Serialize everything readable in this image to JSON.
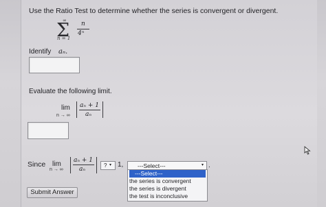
{
  "question": "Use the Ratio Test to determine whether the series is convergent or divergent.",
  "series": {
    "upper": "∞",
    "lower": "n = 1",
    "numerator": "n",
    "denominator": "4ⁿ"
  },
  "identify_label": "Identify",
  "identify_symbol": "aₙ.",
  "evaluate_label": "Evaluate the following limit.",
  "limit": {
    "lim": "lim",
    "sub": "n → ∞",
    "numerator": "aₙ + 1",
    "denominator": "aₙ"
  },
  "since": {
    "label": "Since",
    "compare_value": "?",
    "compare_arrow": "▾",
    "one": "1,",
    "dropdown_selected": "---Select---",
    "dropdown_arrow": "▾",
    "trailing_dot": "."
  },
  "options": [
    "---Select---",
    "the series is convergent",
    "the series is divergent",
    "the test is inconclusive"
  ],
  "submit_label": "Submit Answer",
  "colors": {
    "highlight": "#2f62c9",
    "panel": "#d8d6da"
  }
}
